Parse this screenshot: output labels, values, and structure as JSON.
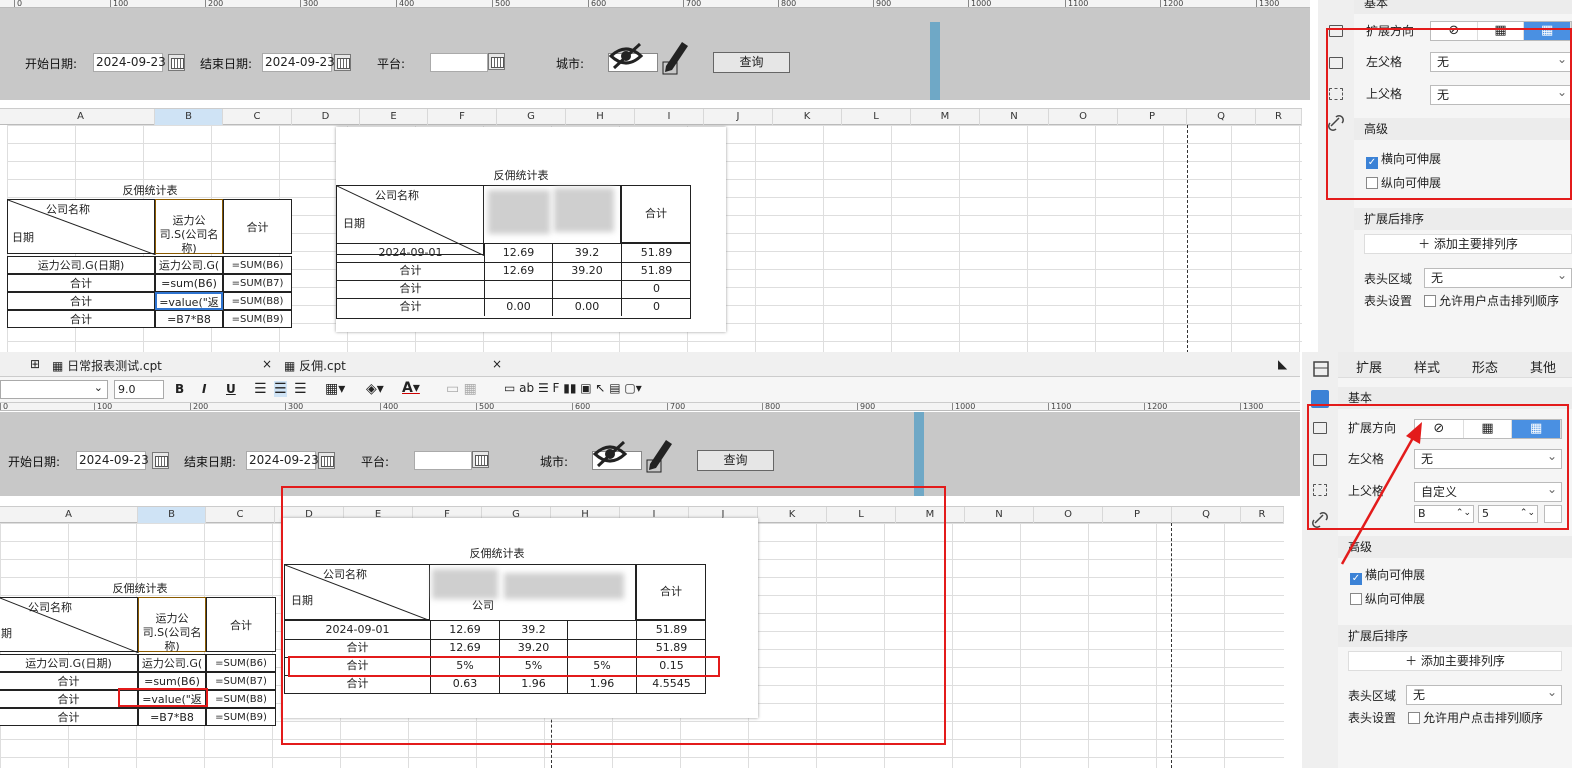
{
  "ruler_ticks": [
    "0",
    "100",
    "200",
    "300",
    "400",
    "500",
    "600",
    "700",
    "800",
    "900",
    "1000",
    "1100",
    "1200",
    "1300"
  ],
  "params": {
    "start_label": "开始日期:",
    "start_value": "2024-09-23",
    "end_label": "结束日期:",
    "end_value": "2024-09-23",
    "platform_label": "平台:",
    "city_label": "城市:",
    "query_label": "查询"
  },
  "columns": [
    "A",
    "B",
    "C",
    "D",
    "E",
    "F",
    "G",
    "H",
    "I",
    "J",
    "K",
    "L",
    "M",
    "N",
    "O",
    "P",
    "Q",
    "R"
  ],
  "design": {
    "title": "反佣统计表",
    "corner_top": "公司名称",
    "corner_bottom": "日期",
    "b_header": "运力公司.S(公司名称)",
    "c_header": "合计",
    "rows": [
      {
        "a": "运力公司.G(日期)",
        "b": "运力公司.G(",
        "c": "=SUM(B6)"
      },
      {
        "a": "合计",
        "b": "=sum(B6)",
        "c": "=SUM(B7)"
      },
      {
        "a": "合计",
        "b": "=value(\"返",
        "c": "=SUM(B8)"
      },
      {
        "a": "合计",
        "b": "=B7*B8",
        "c": "=SUM(B9)"
      }
    ]
  },
  "preview_top": {
    "title": "反佣统计表",
    "corner_top": "公司名称",
    "corner_bottom": "日期",
    "total_header": "合计",
    "rows": [
      [
        "2024-09-01",
        "12.69",
        "39.2",
        "",
        "51.89"
      ],
      [
        "合计",
        "12.69",
        "39.20",
        "",
        "51.89"
      ],
      [
        "合计",
        "",
        "",
        "",
        "0"
      ],
      [
        "合计",
        "0.00",
        "0.00",
        "",
        "0"
      ]
    ]
  },
  "preview_bottom": {
    "title": "反佣统计表",
    "corner_top": "公司名称",
    "corner_bottom": "日期",
    "total_header": "合计",
    "col_fragment": "公司",
    "rows": [
      [
        "2024-09-01",
        "12.69",
        "39.2",
        "",
        "51.89"
      ],
      [
        "合计",
        "12.69",
        "39.20",
        "",
        "51.89"
      ],
      [
        "合计",
        "5%",
        "5%",
        "5%",
        "0.15"
      ],
      [
        "合计",
        "0.63",
        "1.96",
        "1.96",
        "4.5545"
      ]
    ]
  },
  "tabs": [
    {
      "label": "日常报表测试.cpt",
      "close": "×"
    },
    {
      "label": "反佣.cpt",
      "close": "×"
    }
  ],
  "toolbar": {
    "font_size": "9.0",
    "bold": "B",
    "italic": "I",
    "underline": "U"
  },
  "panel_top": {
    "section_basic": "基本",
    "expand_dir": "扩展方向",
    "left_parent": "左父格",
    "left_parent_val": "无",
    "top_parent": "上父格",
    "top_parent_val": "无",
    "advanced": "高级",
    "h_expand": "横向可伸展",
    "v_expand": "纵向可伸展",
    "sort_after": "扩展后排序",
    "add_sort": "添加主要排列序",
    "header_area": "表头区域",
    "header_area_val": "无",
    "header_setting": "表头设置",
    "allow_sort": "允许用户点击排列顺序"
  },
  "panel_bottom": {
    "tabs": [
      "扩展",
      "样式",
      "形态",
      "其他"
    ],
    "section_basic": "基本",
    "expand_dir": "扩展方向",
    "left_parent": "左父格",
    "left_parent_val": "无",
    "top_parent": "上父格",
    "top_parent_val": "自定义",
    "cell_col": "B",
    "cell_row": "5",
    "advanced": "高级",
    "h_expand": "横向可伸展",
    "v_expand": "纵向可伸展",
    "sort_after": "扩展后排序",
    "add_sort": "添加主要排列序",
    "header_area": "表头区域",
    "header_area_val": "无",
    "header_setting": "表头设置",
    "allow_sort": "允许用户点击排列顺序"
  }
}
